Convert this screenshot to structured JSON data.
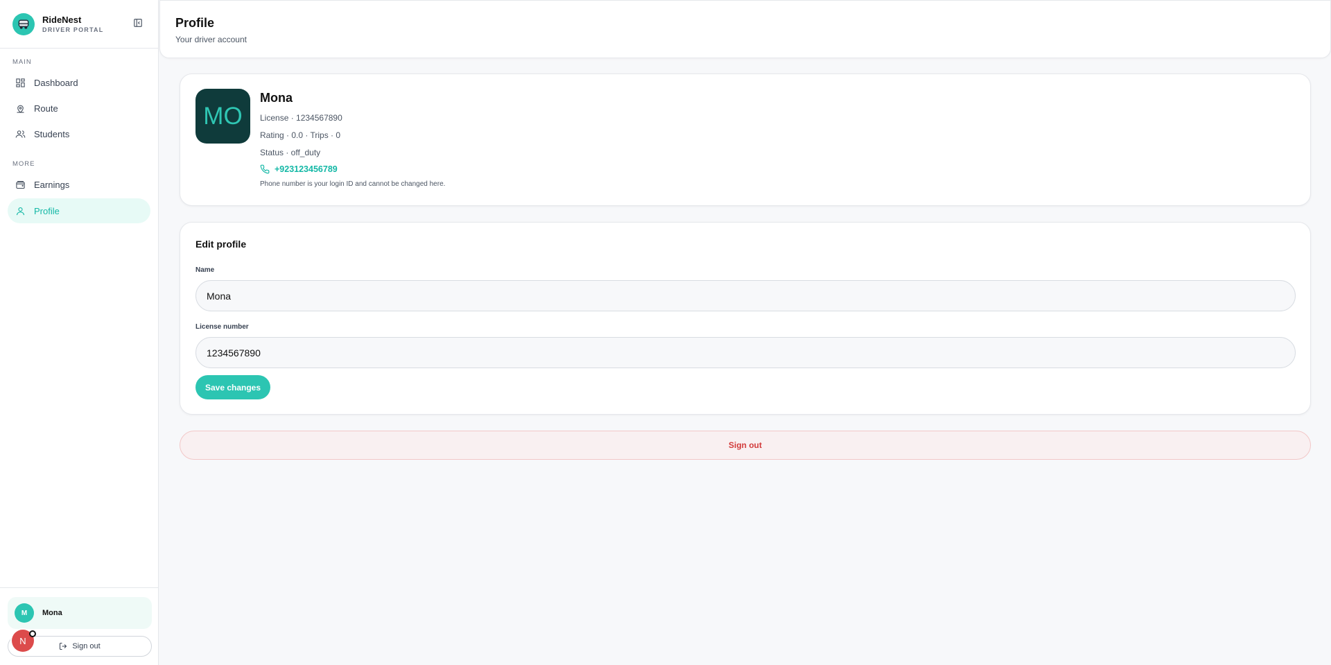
{
  "brand": {
    "name": "RideNest",
    "subtitle": "DRIVER PORTAL"
  },
  "sidebar": {
    "sections": [
      {
        "title": "MAIN",
        "items": [
          "Dashboard",
          "Route",
          "Students"
        ]
      },
      {
        "title": "MORE",
        "items": [
          "Earnings",
          "Profile"
        ]
      }
    ],
    "active_item": "Profile",
    "user": {
      "initial": "M",
      "name": "Mona"
    },
    "signout_label": "Sign out",
    "badge_letter": "N"
  },
  "header": {
    "title": "Profile",
    "subtitle": "Your driver account"
  },
  "profile": {
    "initials": "MO",
    "name": "Mona",
    "license_line": "License · 1234567890",
    "stats_line": "Rating · 0.0 · Trips · 0",
    "status_line": "Status · off_duty",
    "phone": "+923123456789",
    "phone_note": "Phone number is your login ID and cannot be changed here."
  },
  "edit": {
    "title": "Edit profile",
    "name_label": "Name",
    "name_value": "Mona",
    "license_label": "License number",
    "license_value": "1234567890",
    "save_label": "Save changes"
  },
  "signout_label": "Sign out",
  "colors": {
    "accent": "#2cc5b2",
    "danger": "#d23b3b",
    "avatar_bg": "#0f3b3b"
  }
}
